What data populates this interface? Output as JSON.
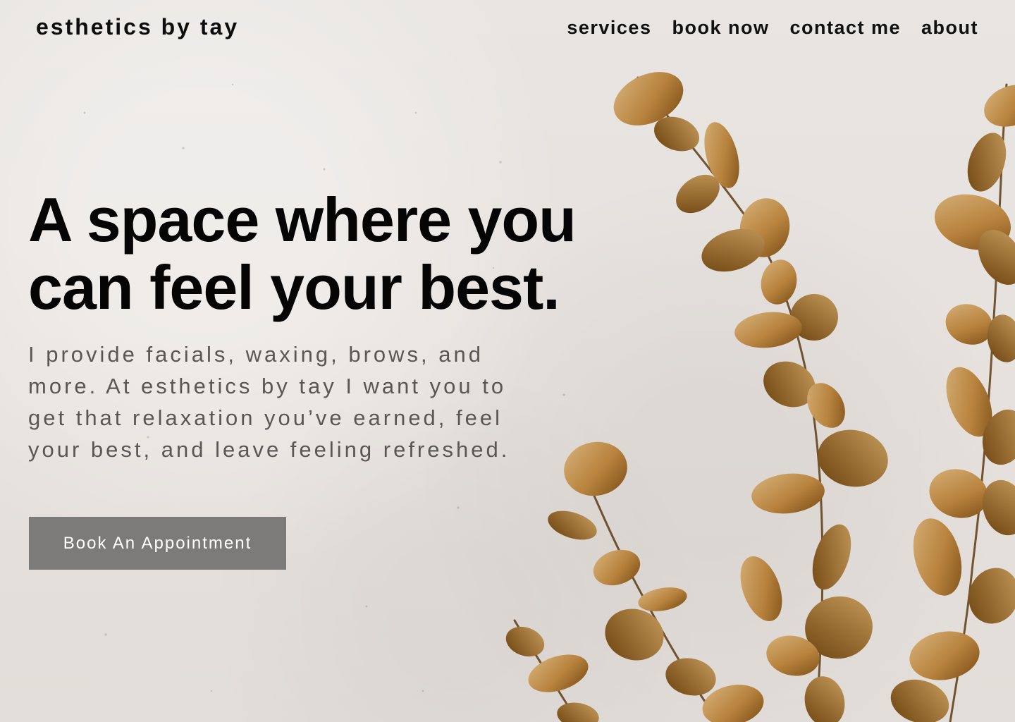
{
  "header": {
    "brand": "esthetics by tay",
    "nav": [
      {
        "label": "services"
      },
      {
        "label": "book now"
      },
      {
        "label": "contact me"
      },
      {
        "label": "about"
      }
    ]
  },
  "hero": {
    "title_line1": "A space where you",
    "title_line2": "can feel your best.",
    "description": "I provide facials, waxing, brows, and more. At esthetics by tay I want you to get that relaxation you’ve earned, feel your best, and leave feeling refreshed.",
    "cta_label": "Book An Appointment"
  },
  "colors": {
    "background": "#e7e3e0",
    "text": "#050505",
    "muted_text": "#5a5654",
    "button": "#7d7b7a",
    "leaf_light": "#c59a5b",
    "leaf_dark": "#7a4d15"
  },
  "decor": {
    "background_image": "eucalyptus-branches"
  }
}
